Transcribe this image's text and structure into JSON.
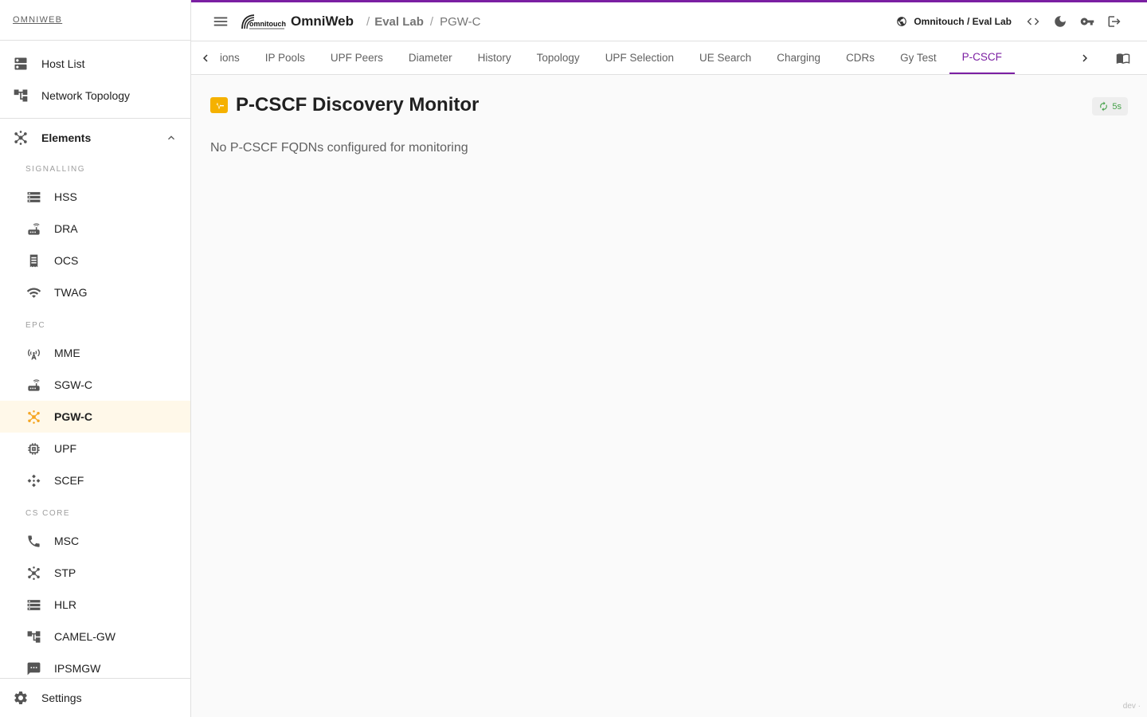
{
  "sidebar": {
    "brand": "OMNIWEB",
    "top_items": [
      {
        "label": "Host List",
        "icon": "dns-icon"
      },
      {
        "label": "Network Topology",
        "icon": "account-tree-icon"
      }
    ],
    "group": {
      "label": "Elements",
      "icon": "hub-icon",
      "expanded": true
    },
    "sections": {
      "signalling": "SIGNALLING",
      "epc": "EPC",
      "cs_core": "CS CORE"
    },
    "signalling_items": [
      {
        "label": "HSS",
        "icon": "storage-icon"
      },
      {
        "label": "DRA",
        "icon": "router-icon"
      },
      {
        "label": "OCS",
        "icon": "receipt-icon"
      },
      {
        "label": "TWAG",
        "icon": "wifi-icon"
      }
    ],
    "epc_items": [
      {
        "label": "MME",
        "icon": "cell-tower-icon"
      },
      {
        "label": "SGW-C",
        "icon": "router-icon"
      },
      {
        "label": "PGW-C",
        "icon": "hub-icon",
        "active": true
      },
      {
        "label": "UPF",
        "icon": "memory-icon"
      },
      {
        "label": "SCEF",
        "icon": "move-icon"
      }
    ],
    "cs_items": [
      {
        "label": "MSC",
        "icon": "phone-icon"
      },
      {
        "label": "STP",
        "icon": "hub-icon"
      },
      {
        "label": "HLR",
        "icon": "storage-icon"
      },
      {
        "label": "CAMEL-GW",
        "icon": "account-tree-icon"
      },
      {
        "label": "IPSMGW",
        "icon": "sms-icon"
      }
    ],
    "settings": "Settings",
    "active_color": "#f5a623"
  },
  "topbar": {
    "app_title": "OmniWeb",
    "logo_text": "omnitouch",
    "breadcrumb": [
      "Eval Lab",
      "PGW-C"
    ],
    "site": "Omnitouch / Eval Lab",
    "accent": "#7b1fa2"
  },
  "tabs": [
    {
      "label": "Sessions"
    },
    {
      "label": "IP Pools"
    },
    {
      "label": "UPF Peers"
    },
    {
      "label": "Diameter"
    },
    {
      "label": "History"
    },
    {
      "label": "Topology"
    },
    {
      "label": "UPF Selection"
    },
    {
      "label": "UE Search"
    },
    {
      "label": "Charging"
    },
    {
      "label": "CDRs"
    },
    {
      "label": "Gy Test"
    },
    {
      "label": "P-CSCF",
      "active": true
    }
  ],
  "main": {
    "title": "P-CSCF Discovery Monitor",
    "refresh": "5s",
    "empty_message": "No P-CSCF FQDNs configured for monitoring",
    "env": "dev ·"
  }
}
